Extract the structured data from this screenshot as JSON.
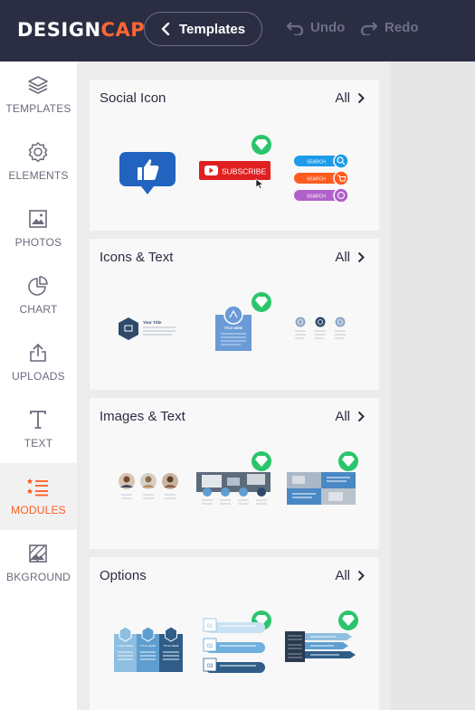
{
  "header": {
    "logo_part1": "DESIGN",
    "logo_part2": "CAP",
    "templates_label": "Templates",
    "undo_label": "Undo",
    "redo_label": "Redo"
  },
  "sidebar": {
    "items": [
      {
        "label": "TEMPLATES",
        "icon": "layers-icon"
      },
      {
        "label": "ELEMENTS",
        "icon": "shapes-icon"
      },
      {
        "label": "PHOTOS",
        "icon": "image-icon"
      },
      {
        "label": "CHART",
        "icon": "pie-chart-icon"
      },
      {
        "label": "UPLOADS",
        "icon": "upload-icon"
      },
      {
        "label": "TEXT",
        "icon": "text-icon"
      },
      {
        "label": "MODULES",
        "icon": "list-icon",
        "active": true
      },
      {
        "label": "BKGROUND",
        "icon": "background-icon"
      }
    ]
  },
  "sections": [
    {
      "title": "Social Icon",
      "all_label": "All"
    },
    {
      "title": "Icons & Text",
      "all_label": "All"
    },
    {
      "title": "Images & Text",
      "all_label": "All"
    },
    {
      "title": "Options",
      "all_label": "All"
    }
  ],
  "thumbs": {
    "subscribe_label": "SUBSCRIBE",
    "search_label": "SEARCH",
    "your_title": "Your Title",
    "title_here": "TITLE HERE"
  },
  "colors": {
    "topbar": "#2b2d42",
    "accent": "#ff5a1f",
    "premium": "#2ac56b"
  }
}
